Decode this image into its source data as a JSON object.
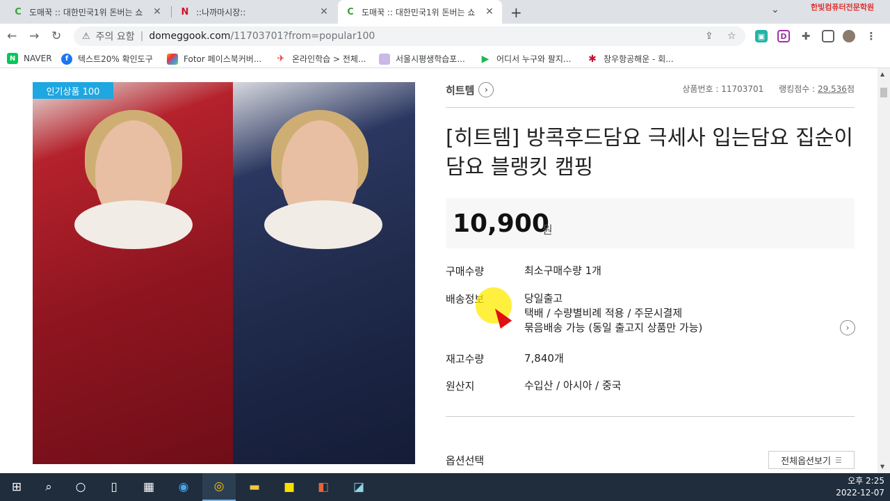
{
  "browser": {
    "tabs": [
      {
        "title": "도매꾹 :: 대한민국1위 돈버는 쇼",
        "favicon": "domeggook-icon",
        "active": false
      },
      {
        "title": "::나까마시장::",
        "favicon": "nakkama-icon",
        "active": false
      },
      {
        "title": "도매꾹 :: 대한민국1위 돈버는 쇼",
        "favicon": "domeggook-icon",
        "active": true
      }
    ],
    "new_tab": "+",
    "tab_menu": "⌄",
    "corner_logo": "한빛컴퓨터전문학원",
    "security_label": "주의 요함",
    "url_host": "domeggook.com",
    "url_path": "/11703701?from=popular100",
    "bookmarks": [
      {
        "label": "NAVER",
        "icon": "naver-icon",
        "color": "#03c75a"
      },
      {
        "label": "텍스트20% 확인도구",
        "icon": "facebook-icon",
        "color": "#1877f2"
      },
      {
        "label": "Fotor 페이스북커버...",
        "icon": "fotor-icon",
        "color": "#f5a623"
      },
      {
        "label": "온라인학습 > 전체...",
        "icon": "plane-icon",
        "color": "#e33"
      },
      {
        "label": "서울시평생학습포...",
        "icon": "doc-icon",
        "color": "#a78bd4"
      },
      {
        "label": "어디서 누구와 팔지...",
        "icon": "play-icon",
        "color": "#1db954"
      },
      {
        "label": "창우항공해운 - 회...",
        "icon": "ship-icon",
        "color": "#c8102e"
      }
    ]
  },
  "product": {
    "badge": "인기상품 100",
    "brand": "히트템",
    "product_no": "상품번호 : 11703701",
    "ranking_label": "랭킹점수 : ",
    "ranking_score": "29.536",
    "ranking_unit": "점",
    "title": "[히트템] 방콕후드담요 극세사 입는담요 집순이담요 블랭킷 캠핑",
    "price": "10,900",
    "currency": "원",
    "rows": [
      {
        "label": "구매수량",
        "lines": [
          "최소구매수량 1개"
        ]
      },
      {
        "label": "배송정보",
        "lines": [
          "당일출고",
          "택배 / 수량별비례 적용 / 주문시결제",
          "묶음배송 가능 (동일 출고지 상품만 가능)"
        ]
      },
      {
        "label": "재고수량",
        "lines": [
          "7,840개"
        ]
      },
      {
        "label": "원산지",
        "lines": [
          "수입산 / 아시아 / 중국"
        ]
      }
    ],
    "options_label": "옵션선택",
    "options_button": "전체옵션보기"
  },
  "taskbar": {
    "time": "오후 2:25",
    "date": "2022-12-07"
  },
  "colors": {
    "badge": "#1ea7e1",
    "cursor": "#e01010",
    "highlight": "#ffeb00"
  }
}
